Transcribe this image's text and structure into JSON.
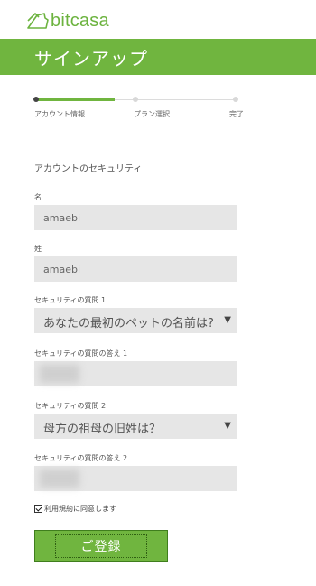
{
  "app": {
    "logo_text": "bitcasa"
  },
  "banner": {
    "title": "サインアップ"
  },
  "steps": [
    {
      "label": "アカウント情報",
      "active": true
    },
    {
      "label": "プラン選択",
      "active": false
    },
    {
      "label": "完了",
      "active": false
    }
  ],
  "progress_fraction": 0.39,
  "form": {
    "section_title": "アカウントのセキュリティ",
    "first_name": {
      "label": "名",
      "value": "amaebi"
    },
    "last_name": {
      "label": "姓",
      "value": "amaebi"
    },
    "question1": {
      "label": "セキュリティの質問 1|",
      "value": "あなたの最初のペットの名前は?"
    },
    "answer1": {
      "label": "セキュリティの質問の答え 1",
      "value": ""
    },
    "question2": {
      "label": "セキュリティの質問 2",
      "value": "母方の祖母の旧姓は？"
    },
    "answer2": {
      "label": "セキュリティの質問の答え 2",
      "value": ""
    },
    "terms_label": "利用規約に同意します",
    "terms_checked": true,
    "submit_label": "ご登録"
  },
  "colors": {
    "brand_green": "#70b53f",
    "field_bg": "#e6e6e6"
  }
}
